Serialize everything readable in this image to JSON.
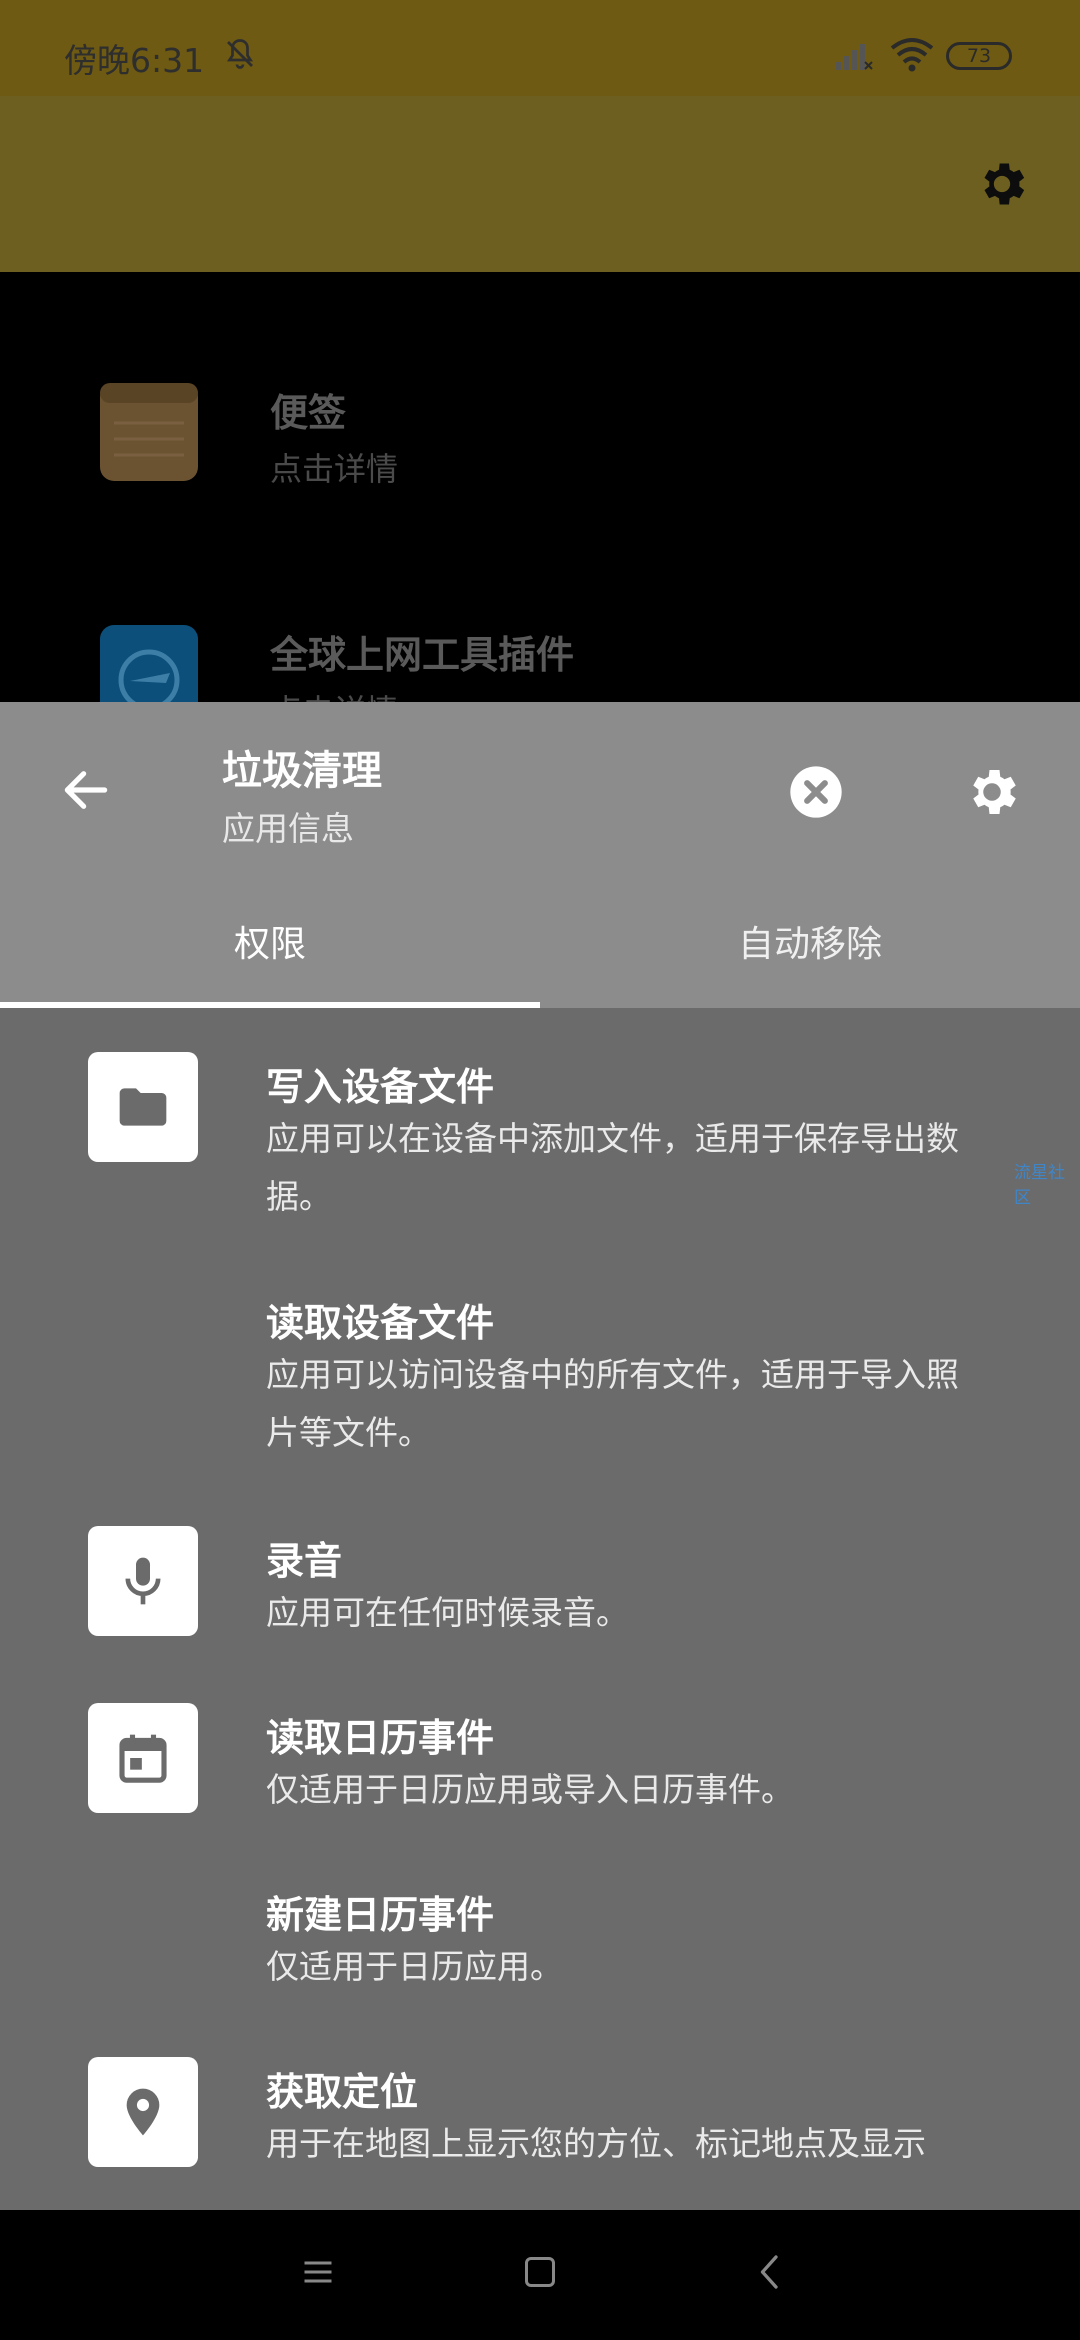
{
  "status_bar": {
    "time": "傍晚6:31",
    "battery": "73"
  },
  "background_list": {
    "items": [
      {
        "title": "便签",
        "subtitle": "点击详情"
      },
      {
        "title": "全球上网工具插件",
        "subtitle": "点击详情"
      }
    ]
  },
  "sheet": {
    "title": "垃圾清理",
    "subtitle": "应用信息",
    "tabs": [
      {
        "label": "权限",
        "active": true
      },
      {
        "label": "自动移除",
        "active": false
      }
    ],
    "permissions": [
      {
        "title": "写入设备文件",
        "description": "应用可以在设备中添加文件，适用于保存导出数据。",
        "icon": "folder-icon"
      },
      {
        "title": "读取设备文件",
        "description": "应用可以访问设备中的所有文件，适用于导入照片等文件。",
        "icon": ""
      },
      {
        "title": "录音",
        "description": "应用可在任何时候录音。",
        "icon": "microphone-icon"
      },
      {
        "title": "读取日历事件",
        "description": "仅适用于日历应用或导入日历事件。",
        "icon": "calendar-icon"
      },
      {
        "title": "新建日历事件",
        "description": "仅适用于日历应用。",
        "icon": ""
      },
      {
        "title": "获取定位",
        "description": "用于在地图上显示您的方位、标记地点及显示",
        "icon": "location-pin-icon"
      }
    ]
  },
  "watermark": "流星社区",
  "colors": {
    "accent": "#6e5a12",
    "sheet_header": "#8c8c8c",
    "sheet_body": "#6b6b6b"
  }
}
